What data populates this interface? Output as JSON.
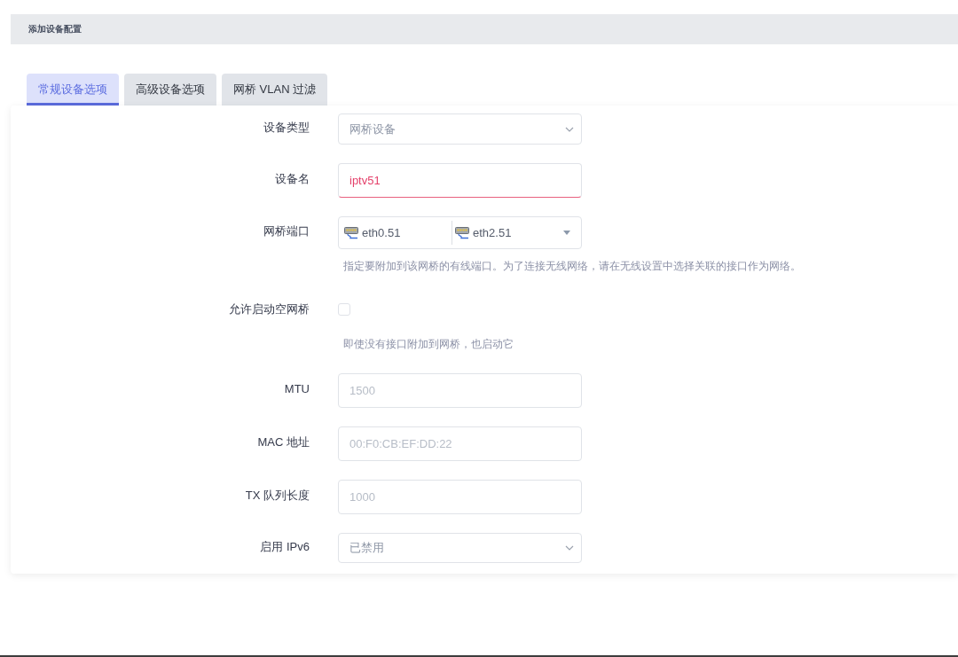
{
  "header": {
    "title": "添加设备配置"
  },
  "tabs": [
    {
      "label": "常规设备选项",
      "selected": true
    },
    {
      "label": "高级设备选项",
      "selected": false
    },
    {
      "label": "网桥 VLAN 过滤",
      "selected": false
    }
  ],
  "form": {
    "fields": [
      {
        "kind": "select",
        "label": "设备类型",
        "value": "网桥设备"
      },
      {
        "kind": "text",
        "label": "设备名",
        "value": "iptv51",
        "invalid": true
      },
      {
        "kind": "ports",
        "label": "网桥端口",
        "ports": [
          "eth0.51",
          "eth2.51"
        ],
        "description": "指定要附加到该网桥的有线端口。为了连接无线网络，请在无线设置中选择关联的接口作为网络。"
      },
      {
        "kind": "checkbox",
        "label": "允许启动空网桥",
        "checked": false,
        "description": "即使没有接口附加到网桥，也启动它"
      },
      {
        "kind": "text",
        "label": "MTU",
        "placeholder": "1500"
      },
      {
        "kind": "text",
        "label": "MAC 地址",
        "placeholder": "00:F0:CB:EF:DD:22"
      },
      {
        "kind": "text",
        "label": "TX 队列长度",
        "placeholder": "1000"
      },
      {
        "kind": "select",
        "label": "启用 IPv6",
        "value": "已禁用"
      }
    ]
  }
}
